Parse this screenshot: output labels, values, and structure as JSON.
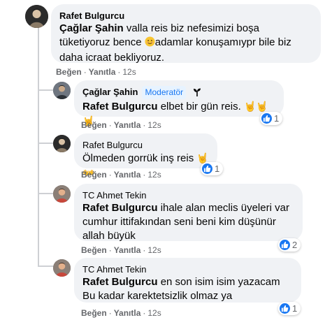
{
  "comments": [
    {
      "author": "Rafet Bulgurcu",
      "tag": "Çağlar Şahin",
      "text_before_emoji": "valla reis biz nefesimizi boşa tüketiyoruz bence",
      "text_after_emoji": "adamlar konuşamıypr bile biz daha icraat bekliyoruz.",
      "actions": {
        "like": "Beğen",
        "reply": "Yanıtla",
        "time": "12s"
      }
    },
    {
      "author": "Çağlar Şahin",
      "badge": "Moderatör",
      "tag": "Rafet Bulgurcu",
      "text": "elbet bir gün reis.",
      "reaction_count": "1",
      "actions": {
        "like": "Beğen",
        "reply": "Yanıtla",
        "time": "12s"
      }
    },
    {
      "author": "Rafet Bulgurcu",
      "text": "Ölmeden gorrük inş reis",
      "reaction_count": "1",
      "actions": {
        "like": "Beğen",
        "reply": "Yanıtla",
        "time": "12s"
      }
    },
    {
      "author": "TC Ahmet Tekin",
      "tag": "Rafet Bulgurcu",
      "text": "ihale alan meclis üyeleri var cumhur ittifakından seni beni kim düşünür allah büyük",
      "reaction_count": "2",
      "actions": {
        "like": "Beğen",
        "reply": "Yanıtla",
        "time": "12s"
      }
    },
    {
      "author": "TC Ahmet Tekin",
      "tag": "Rafet Bulgurcu",
      "text": "en son isim isim yazacam Bu kadar karektetsizlik olmaz ya",
      "reaction_count": "1",
      "actions": {
        "like": "Beğen",
        "reply": "Yanıtla",
        "time": "12s"
      }
    }
  ],
  "colors": {
    "bubble": "#f0f2f5",
    "meta": "#65676b",
    "like_blue": "#1877f2",
    "thread_line": "#ced0d4"
  }
}
